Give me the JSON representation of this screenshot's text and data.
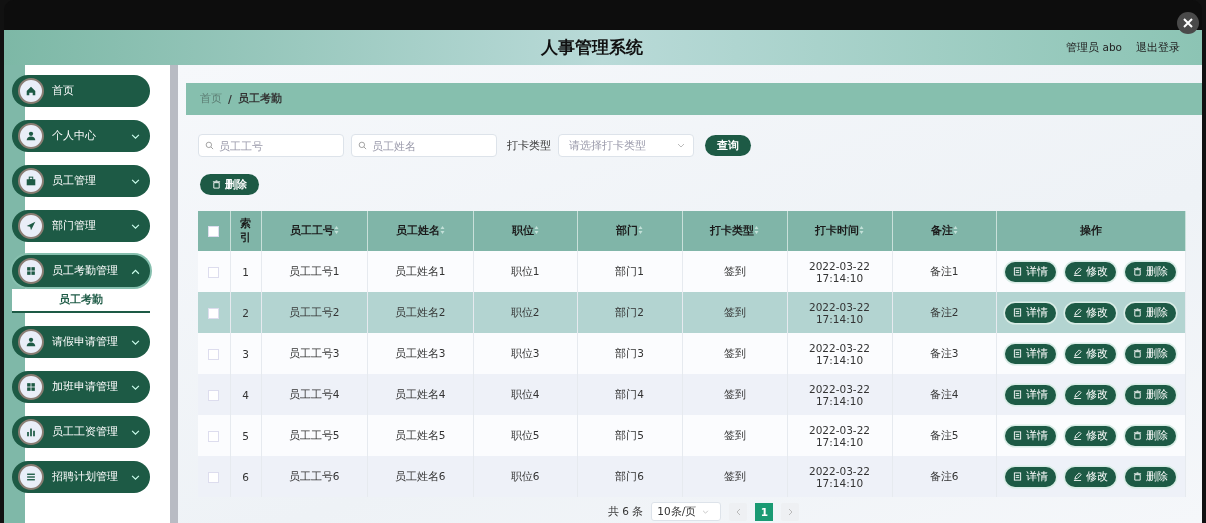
{
  "header": {
    "title": "人事管理系统",
    "user": "管理员 abo",
    "logout": "退出登录"
  },
  "sidebar": {
    "items": [
      {
        "label": "首页",
        "expandable": false,
        "expanded": false
      },
      {
        "label": "个人中心",
        "expandable": true,
        "expanded": false
      },
      {
        "label": "员工管理",
        "expandable": true,
        "expanded": false
      },
      {
        "label": "部门管理",
        "expandable": true,
        "expanded": false
      },
      {
        "label": "员工考勤管理",
        "expandable": true,
        "expanded": true,
        "children": [
          {
            "label": "员工考勤",
            "selected": true
          }
        ]
      },
      {
        "label": "请假申请管理",
        "expandable": true,
        "expanded": false
      },
      {
        "label": "加班申请管理",
        "expandable": true,
        "expanded": false
      },
      {
        "label": "员工工资管理",
        "expandable": true,
        "expanded": false
      },
      {
        "label": "招聘计划管理",
        "expandable": true,
        "expanded": false
      }
    ]
  },
  "breadcrumb": {
    "items": [
      "首页",
      "员工考勤"
    ],
    "separator": "/"
  },
  "filters": {
    "fields": [
      {
        "placeholder": "员工工号"
      },
      {
        "placeholder": "员工姓名"
      }
    ],
    "select": {
      "label": "打卡类型",
      "placeholder": "请选择打卡类型"
    },
    "search_button": "查询"
  },
  "delete_button": "删除",
  "table": {
    "header_checked": false,
    "columns": [
      {
        "label": "索引",
        "sortable": false
      },
      {
        "label": "员工工号",
        "sortable": true
      },
      {
        "label": "员工姓名",
        "sortable": true
      },
      {
        "label": "职位",
        "sortable": true
      },
      {
        "label": "部门",
        "sortable": true
      },
      {
        "label": "打卡类型",
        "sortable": true
      },
      {
        "label": "打卡时间",
        "sortable": true
      },
      {
        "label": "备注",
        "sortable": true
      },
      {
        "label": "操作",
        "sortable": false
      }
    ],
    "rows": [
      {
        "checked": false,
        "highlighted": false,
        "cells": [
          "1",
          "员工工号1",
          "员工姓名1",
          "职位1",
          "部门1",
          "签到",
          "2022-03-22 17:14:10",
          "备注1"
        ],
        "actions": [
          "详情",
          "修改",
          "删除"
        ]
      },
      {
        "checked": false,
        "highlighted": true,
        "cells": [
          "2",
          "员工工号2",
          "员工姓名2",
          "职位2",
          "部门2",
          "签到",
          "2022-03-22 17:14:10",
          "备注2"
        ],
        "actions": [
          "详情",
          "修改",
          "删除"
        ]
      },
      {
        "checked": false,
        "highlighted": false,
        "cells": [
          "3",
          "员工工号3",
          "员工姓名3",
          "职位3",
          "部门3",
          "签到",
          "2022-03-22 17:14:10",
          "备注3"
        ],
        "actions": [
          "详情",
          "修改",
          "删除"
        ]
      },
      {
        "checked": false,
        "highlighted": false,
        "cells": [
          "4",
          "员工工号4",
          "员工姓名4",
          "职位4",
          "部门4",
          "签到",
          "2022-03-22 17:14:10",
          "备注4"
        ],
        "actions": [
          "详情",
          "修改",
          "删除"
        ]
      },
      {
        "checked": false,
        "highlighted": false,
        "cells": [
          "5",
          "员工工号5",
          "员工姓名5",
          "职位5",
          "部门5",
          "签到",
          "2022-03-22 17:14:10",
          "备注5"
        ],
        "actions": [
          "详情",
          "修改",
          "删除"
        ]
      },
      {
        "checked": false,
        "highlighted": false,
        "cells": [
          "6",
          "员工工号6",
          "员工姓名6",
          "职位6",
          "部门6",
          "签到",
          "2022-03-22 17:14:10",
          "备注6"
        ],
        "actions": [
          "详情",
          "修改",
          "删除"
        ]
      }
    ]
  },
  "pagination": {
    "total": "共 6 条",
    "page_size": "10条/页",
    "pages": [
      {
        "label": "1",
        "selected": true
      }
    ]
  }
}
